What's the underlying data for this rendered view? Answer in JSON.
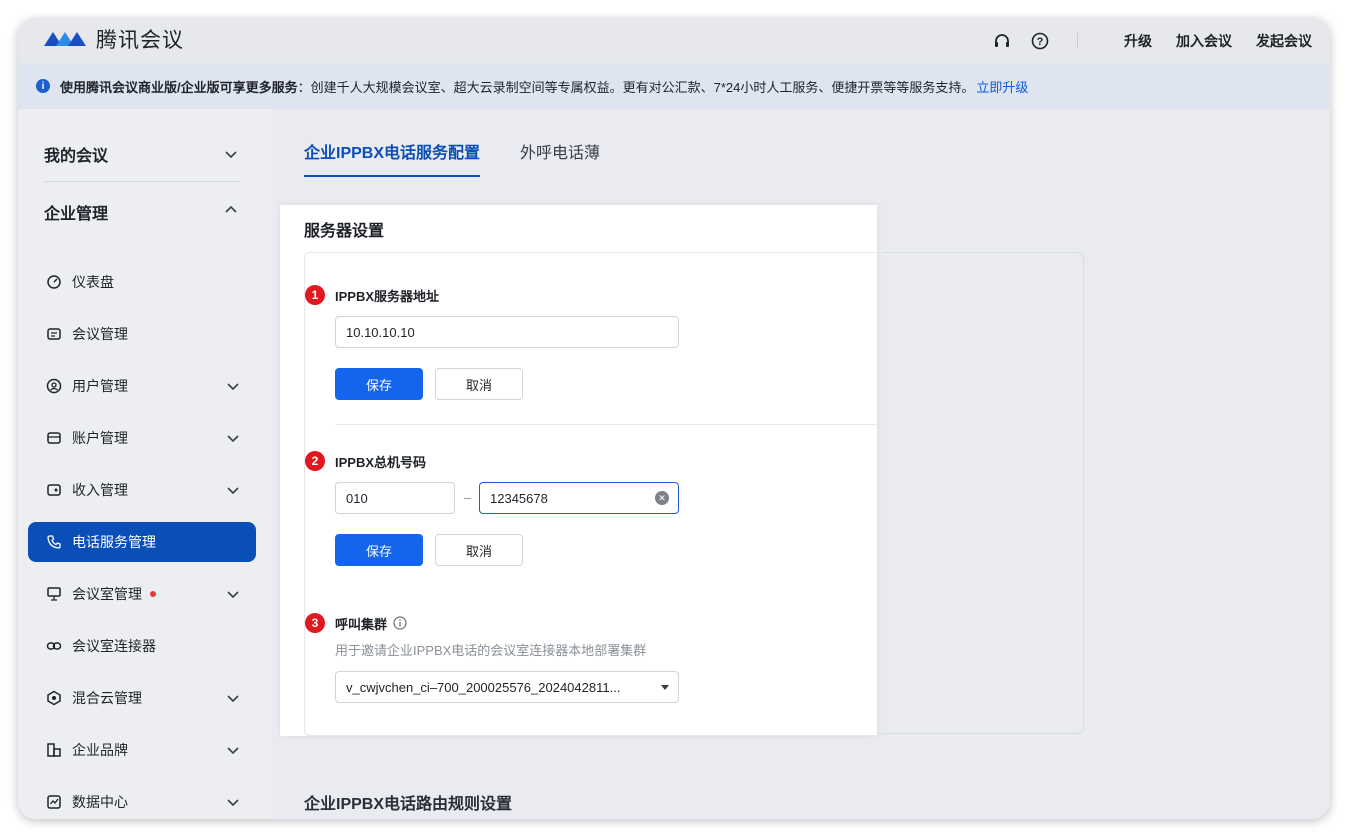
{
  "app": {
    "name": "腾讯会议"
  },
  "topbar": {
    "upgrade": "升级",
    "join": "加入会议",
    "start": "发起会议"
  },
  "notice": {
    "strong": "使用腾讯会议商业版/企业版可享更多服务",
    "text": "：创建千人大规模会议室、超大云录制空间等专属权益。更有对公汇款、7*24小时人工服务、便捷开票等等服务支持。",
    "link": "立即升级"
  },
  "sidebar": {
    "my_meetings": "我的会议",
    "enterprise": "企业管理",
    "items": [
      {
        "label": "仪表盘",
        "icon": "dashboard-icon"
      },
      {
        "label": "会议管理",
        "icon": "list-icon"
      },
      {
        "label": "用户管理",
        "icon": "user-icon"
      },
      {
        "label": "账户管理",
        "icon": "wallet-icon"
      },
      {
        "label": "收入管理",
        "icon": "income-icon"
      },
      {
        "label": "电话服务管理",
        "icon": "phone-icon"
      },
      {
        "label": "会议室管理",
        "icon": "room-icon"
      },
      {
        "label": "会议室连接器",
        "icon": "link-icon"
      },
      {
        "label": "混合云管理",
        "icon": "cloud-icon"
      },
      {
        "label": "企业品牌",
        "icon": "brand-icon"
      },
      {
        "label": "数据中心",
        "icon": "data-icon"
      }
    ]
  },
  "tabs": {
    "config": "企业IPPBX电话服务配置",
    "phonebook": "外呼电话薄"
  },
  "panel": {
    "title": "服务器设置",
    "step1": {
      "num": "1",
      "label": "IPPBX服务器地址",
      "value": "10.10.10.10"
    },
    "step2": {
      "num": "2",
      "label": "IPPBX总机号码",
      "area": "010",
      "dash": "–",
      "number": "12345678"
    },
    "step3": {
      "num": "3",
      "label": "呼叫集群",
      "desc": "用于邀请企业IPPBX电话的会议室连接器本地部署集群",
      "selected": "v_cwjvchen_ci–700_200025576_2024042811..."
    },
    "save": "保存",
    "cancel": "取消"
  },
  "route": {
    "title": "企业IPPBX电话路由规则设置"
  },
  "colors": {
    "accent": "#0a4fb8",
    "primary_button": "#1366ec",
    "step_badge": "#e0191e"
  }
}
